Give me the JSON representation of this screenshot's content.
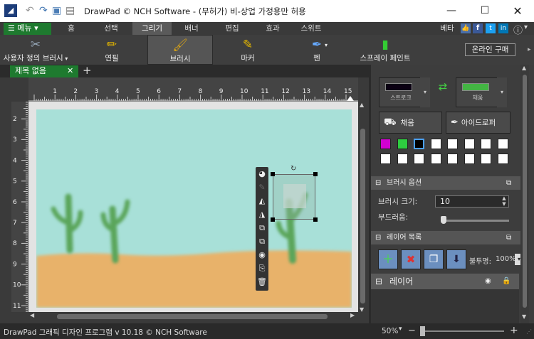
{
  "window": {
    "title": "DrawPad © NCH Software - (무허가) 비-상업 가정용만 허용",
    "min_icon": "minimize-icon",
    "max_icon": "maximize-icon",
    "close_icon": "close-icon"
  },
  "menubar": {
    "menu_label": "메뉴",
    "tabs": [
      "홈",
      "선택",
      "그리기",
      "배너",
      "편집",
      "효과",
      "스위트"
    ],
    "active_tab": "그리기",
    "beta": "베타"
  },
  "toolbar": {
    "tools": [
      "사용자 정의 브러시",
      "연필",
      "브러시",
      "마커",
      "펜",
      "스프레이 페인트"
    ],
    "active": "브러시",
    "online_buy": "온라인 구매"
  },
  "document": {
    "tab_name": "제목 없음"
  },
  "ruler": {
    "h_labels": [
      "1",
      "2",
      "3",
      "4",
      "5",
      "6",
      "7",
      "8",
      "9",
      "10",
      "11",
      "12",
      "13",
      "14",
      "15"
    ],
    "v_labels": [
      "2",
      "3",
      "4",
      "5",
      "6",
      "7",
      "8",
      "9",
      "10",
      "11"
    ]
  },
  "right": {
    "stroke_label": "스트로크",
    "fill_swatch_label": "채움",
    "fill_button": "채움",
    "eyedropper_button": "아이드로퍼",
    "brush_options": "브러시 옵션",
    "brush_size_label": "브러시 크기:",
    "brush_size_value": "10",
    "softness_label": "부드러움:",
    "layer_list": "레이어 목록",
    "opacity_label": "불투명:",
    "opacity_value": "100%",
    "layer_header": "레이어"
  },
  "colors": {
    "accent": "#1e7a2f",
    "swatches": [
      "#d000d0",
      "#2ecc40",
      "#000000",
      "#ffffff",
      "#ffffff",
      "#ffffff",
      "#ffffff",
      "#ffffff",
      "#ffffff",
      "#ffffff",
      "#ffffff",
      "#ffffff",
      "#ffffff",
      "#ffffff",
      "#ffffff",
      "#ffffff"
    ]
  },
  "status": {
    "text": "DrawPad 그래픽 디자인 프로그램 v 10.18 © NCH Software",
    "zoom": "50%",
    "minus": "−",
    "plus": "+"
  }
}
